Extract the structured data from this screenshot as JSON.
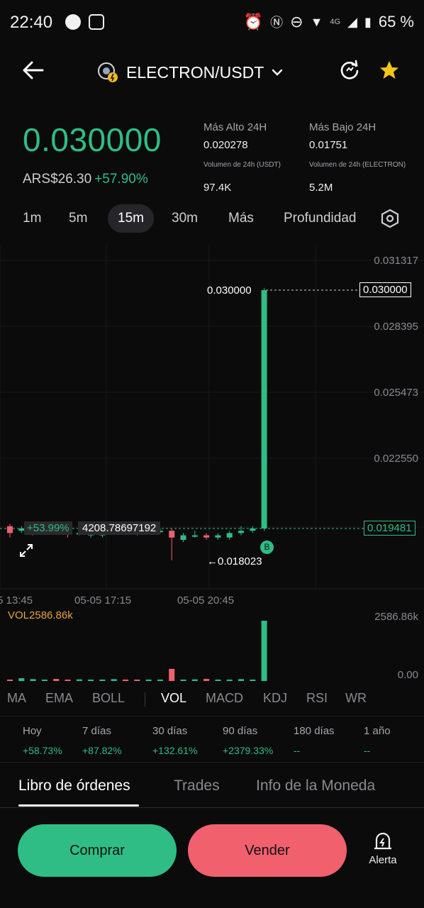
{
  "status_bar": {
    "time": "22:40",
    "network": "4G",
    "battery": "65 %"
  },
  "header": {
    "pair": "ELECTRON/USDT"
  },
  "price": {
    "last": "0.030000",
    "fiat": "ARS$26.30",
    "change": "+57.90%"
  },
  "stats": {
    "high_label": "Más Alto 24H",
    "high_value": "0.020278",
    "low_label": "Más Bajo 24H",
    "low_value": "0.01751",
    "vol_usdt_label": "Volumen de 24h (USDT)",
    "vol_usdt_value": "97.4K",
    "vol_electron_label": "Volumen de 24h (ELECTRON)",
    "vol_electron_value": "5.2M"
  },
  "timeframes": [
    "1m",
    "5m",
    "15m",
    "30m",
    "Más",
    "Profundidad"
  ],
  "active_timeframe": "15m",
  "chart_data": {
    "type": "candlestick",
    "y_ticks": [
      "0.031317",
      "0.028395",
      "0.025473",
      "0.022550",
      "0.019481"
    ],
    "x_ticks": [
      "5 13:45",
      "05-05 17:15",
      "05-05 20:45"
    ],
    "last_price_label": "0.030000",
    "last_price_tag": "0.030000",
    "current_price_tag": "0.019481",
    "low_marker": "←0.018023",
    "overlay_change": "+53.99%",
    "overlay_value": "4208.78697192",
    "buy_marker": "B",
    "volume_label": "VOL2586.86k",
    "volume_max": "2586.86k",
    "volume_min": "0.00",
    "candles": [
      {
        "o": 0.0196,
        "c": 0.0193,
        "h": 0.0197,
        "l": 0.0191
      },
      {
        "o": 0.0194,
        "c": 0.0195,
        "h": 0.0196,
        "l": 0.0193
      },
      {
        "o": 0.0193,
        "c": 0.0196,
        "h": 0.0198,
        "l": 0.0192
      },
      {
        "o": 0.0195,
        "c": 0.0196,
        "h": 0.0196,
        "l": 0.0194
      },
      {
        "o": 0.0196,
        "c": 0.0195,
        "h": 0.0196,
        "l": 0.0193
      },
      {
        "o": 0.0194,
        "c": 0.0193,
        "h": 0.0194,
        "l": 0.0191
      },
      {
        "o": 0.0193,
        "c": 0.0193,
        "h": 0.0195,
        "l": 0.0192
      },
      {
        "o": 0.0192,
        "c": 0.0193,
        "h": 0.0195,
        "l": 0.0191
      },
      {
        "o": 0.0192,
        "c": 0.0194,
        "h": 0.0195,
        "l": 0.0191
      },
      {
        "o": 0.0195,
        "c": 0.0195,
        "h": 0.0196,
        "l": 0.0193
      },
      {
        "o": 0.0195,
        "c": 0.0194,
        "h": 0.0195,
        "l": 0.0193
      },
      {
        "o": 0.0194,
        "c": 0.0193,
        "h": 0.0195,
        "l": 0.0192
      },
      {
        "o": 0.0193,
        "c": 0.0194,
        "h": 0.0195,
        "l": 0.0193
      },
      {
        "o": 0.0194,
        "c": 0.0194,
        "h": 0.0195,
        "l": 0.0193
      },
      {
        "o": 0.0194,
        "c": 0.0191,
        "h": 0.0195,
        "l": 0.0181
      },
      {
        "o": 0.019,
        "c": 0.0192,
        "h": 0.0193,
        "l": 0.0189
      },
      {
        "o": 0.0192,
        "c": 0.0192,
        "h": 0.0194,
        "l": 0.0191
      },
      {
        "o": 0.0192,
        "c": 0.0191,
        "h": 0.0193,
        "l": 0.019
      },
      {
        "o": 0.0191,
        "c": 0.0192,
        "h": 0.0193,
        "l": 0.019
      },
      {
        "o": 0.0191,
        "c": 0.0193,
        "h": 0.0194,
        "l": 0.019
      },
      {
        "o": 0.0193,
        "c": 0.0194,
        "h": 0.0196,
        "l": 0.0192
      },
      {
        "o": 0.0194,
        "c": 0.0195,
        "h": 0.0196,
        "l": 0.0193
      },
      {
        "o": 0.0195,
        "c": 0.03,
        "h": 0.0301,
        "l": 0.0194
      }
    ],
    "volumes": [
      40,
      120,
      80,
      60,
      90,
      50,
      70,
      40,
      60,
      80,
      50,
      40,
      60,
      45,
      520,
      60,
      70,
      90,
      50,
      60,
      80,
      50,
      2586.86
    ]
  },
  "indicators": [
    "MA",
    "EMA",
    "BOLL",
    "VOL",
    "MACD",
    "KDJ",
    "RSI",
    "WR"
  ],
  "active_indicator": "VOL",
  "performance": [
    {
      "label": "Hoy",
      "value": "+58.73%"
    },
    {
      "label": "7 días",
      "value": "+87.82%"
    },
    {
      "label": "30 días",
      "value": "+132.61%"
    },
    {
      "label": "90 días",
      "value": "+2379.33%"
    },
    {
      "label": "180 días",
      "value": "--"
    },
    {
      "label": "1 año",
      "value": "--"
    }
  ],
  "bottom_tabs": [
    "Libro de órdenes",
    "Trades",
    "Info de la Moneda"
  ],
  "actions": {
    "buy": "Comprar",
    "sell": "Vender",
    "alert": "Alerta"
  },
  "colors": {
    "up": "#2fbd85",
    "down": "#f0616d",
    "background": "#0b0b0c"
  }
}
